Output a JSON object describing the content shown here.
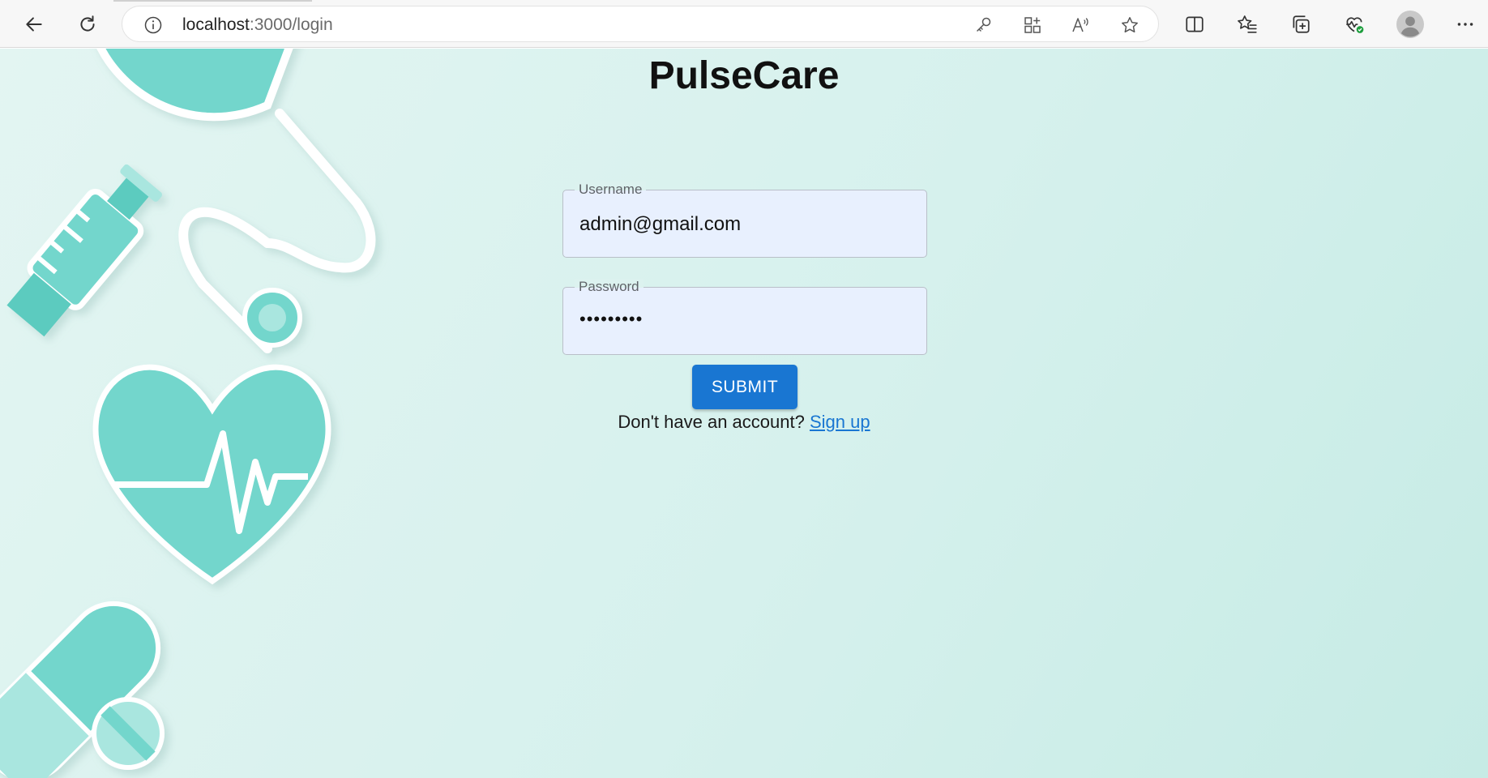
{
  "browser": {
    "url_host": "localhost",
    "url_path": ":3000/login",
    "icons": {
      "back": "back-arrow-icon",
      "refresh": "refresh-icon",
      "info": "info-icon",
      "key": "key-icon",
      "apps": "apps-icon",
      "read_aloud": "read-aloud-icon",
      "favorite": "star-icon",
      "split": "split-screen-icon",
      "favorites": "favorites-list-icon",
      "collections": "collections-icon",
      "health": "browser-essentials-icon",
      "profile": "profile-avatar-icon",
      "more": "more-options-icon"
    }
  },
  "app": {
    "title": "PulseCare"
  },
  "login": {
    "username_label": "Username",
    "username_value": "admin@gmail.com",
    "password_label": "Password",
    "password_value": "•••••••••",
    "submit_label": "SUBMIT",
    "signup_prompt": "Don't have an account?",
    "signup_link": "Sign up"
  },
  "colors": {
    "accent": "#1976d2",
    "teal": "#73d6cc",
    "field_bg": "#e8f0fe"
  }
}
